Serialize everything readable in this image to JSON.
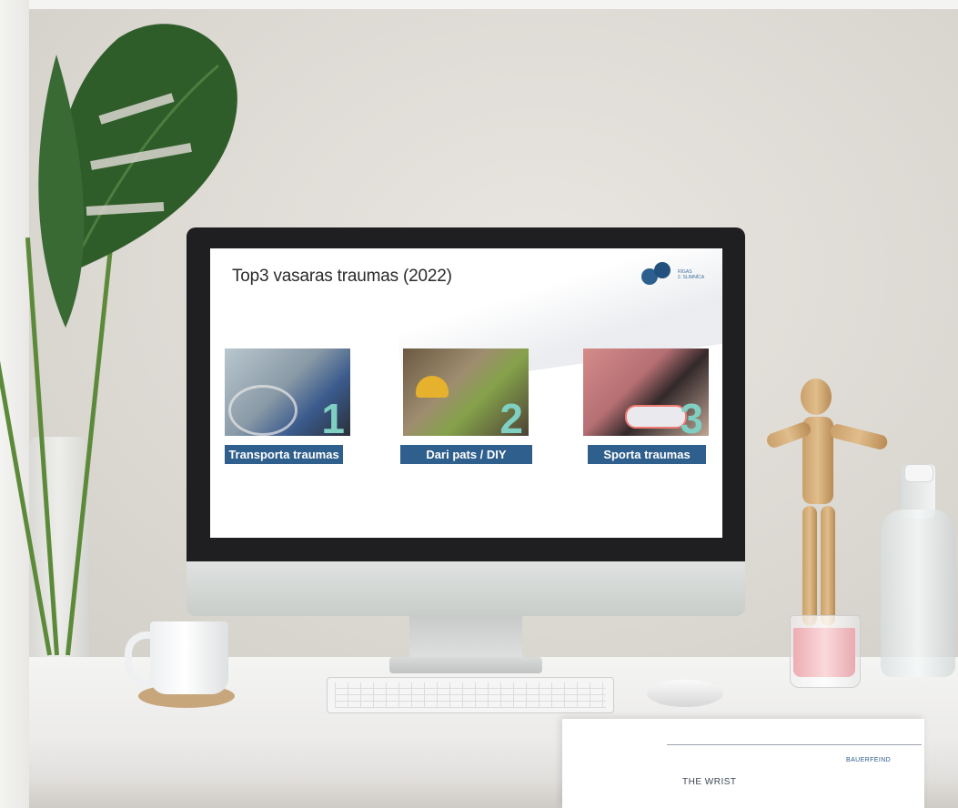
{
  "slide": {
    "title": "Top3 vasaras traumas (2022)",
    "logo_text_line1": "RĪGAS",
    "logo_text_line2": "2. SLIMNĪCA",
    "items": [
      {
        "number": "1",
        "label": "Transporta traumas"
      },
      {
        "number": "2",
        "label": "Dari pats / DIY"
      },
      {
        "number": "3",
        "label": "Sporta traumas"
      }
    ]
  },
  "brochure": {
    "title": "THE WRIST",
    "brand": "BAUERFEIND"
  },
  "colors": {
    "label_bg": "#2f5f8d",
    "number_accent": "#7fcfc2",
    "logo_blue": "#24507d"
  }
}
